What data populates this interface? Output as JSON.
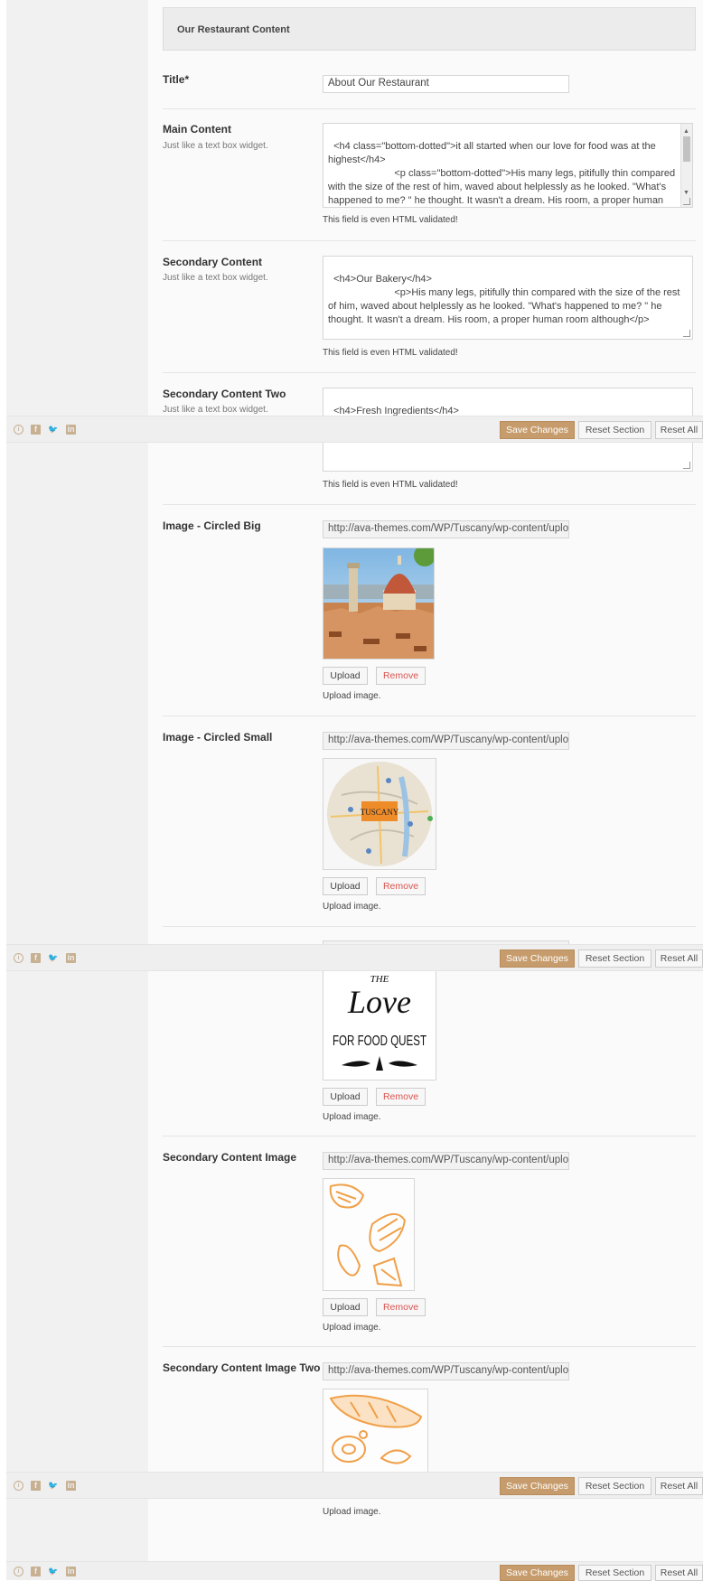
{
  "section": {
    "title": "Our Restaurant Content"
  },
  "fields": {
    "title": {
      "label": "Title*",
      "value": "About Our Restaurant"
    },
    "main_content": {
      "label": "Main Content",
      "desc": "Just like a text box widget.",
      "value": "<h4 class=\"bottom-dotted\">it all started when our love for food was at the highest</h4>\n                        <p class=\"bottom-dotted\">His many legs, pitifully thin compared with the size of the rest of him, waved about helplessly as he looked. \"What's happened to me? \" he thought. It wasn't a dream. His room, a proper human room although a little too small, lay peacefully between its",
      "help": "This field is even HTML validated!"
    },
    "secondary_content": {
      "label": "Secondary Content",
      "desc": "Just like a text box widget.",
      "value": "<h4>Our Bakery</h4>\n                        <p>His many legs, pitifully thin compared with the size of the rest of him, waved about helplessly as he looked. \"What's happened to me? \" he thought. It wasn't a dream. His room, a proper human room although</p>",
      "help": "This field is even HTML validated!"
    },
    "secondary_content_two": {
      "label": "Secondary Content Two",
      "desc": "Just like a text box widget.",
      "value": "<h4>Fresh Ingredients</h4>\n                        <p>His many legs, pitifully thin compared with the size of the",
      "help": "This field is even HTML validated!"
    },
    "image_circled_big": {
      "label": "Image - Circled Big",
      "url": "http://ava-themes.com/WP/Tuscany/wp-content/uploads/2014/07/florence.jpg",
      "upload": "Upload",
      "remove": "Remove",
      "help": "Upload image."
    },
    "image_circled_small": {
      "label": "Image - Circled Small",
      "url": "http://ava-themes.com/WP/Tuscany/wp-content/uploads/2014/07/map.jpg",
      "logo_text": "TUSCANY",
      "upload": "Upload",
      "remove": "Remove",
      "help": "Upload image."
    },
    "image_love": {
      "lettering": [
        "THE",
        "Love",
        "FOR FOOD QUEST"
      ],
      "upload": "Upload",
      "remove": "Remove",
      "help": "Upload image."
    },
    "secondary_content_image": {
      "label": "Secondary Content Image",
      "url": "http://ava-themes.com/WP/Tuscany/wp-content/uploads/2014/07/pastry.jpg",
      "upload": "Upload",
      "remove": "Remove",
      "help": "Upload image."
    },
    "secondary_content_image_two": {
      "label": "Secondary Content Image Two",
      "url": "http://ava-themes.com/WP/Tuscany/wp-content/uploads/2014/07/bread.jpg",
      "help": "Upload image."
    }
  },
  "toolbar": {
    "save": "Save Changes",
    "reset_section": "Reset Section",
    "reset_all": "Reset All"
  },
  "icons": [
    "info-icon",
    "facebook-icon",
    "twitter-icon",
    "linkedin-icon"
  ],
  "colors": {
    "accent": "#c69c6d",
    "remove": "#d9544f",
    "illustration": "#f0a048"
  }
}
